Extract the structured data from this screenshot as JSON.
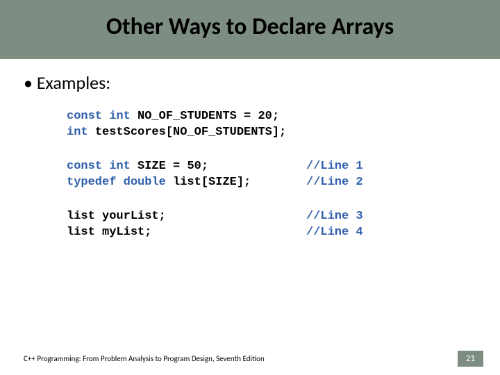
{
  "title": "Other Ways to Declare Arrays",
  "bullet": "Examples:",
  "code": {
    "b1r1": {
      "kw": "const int ",
      "tok": "NO_OF_STUDENTS = 20;"
    },
    "b1r2": {
      "kw": "int ",
      "tok": "testScores[NO_OF_STUDENTS];"
    },
    "b2r1": {
      "kw": "const int ",
      "tok": "SIZE = 50;",
      "cmt": "//Line 1"
    },
    "b2r2": {
      "kw": "typedef double ",
      "tok": "list[SIZE];",
      "cmt": "//Line 2"
    },
    "b3r1": {
      "tok": "list yourList;",
      "cmt": "//Line 3"
    },
    "b3r2": {
      "tok": "list myList;",
      "cmt": "//Line 4"
    }
  },
  "footer": "C++ Programming: From Problem Analysis to Program Design, Seventh Edition",
  "page": "21"
}
